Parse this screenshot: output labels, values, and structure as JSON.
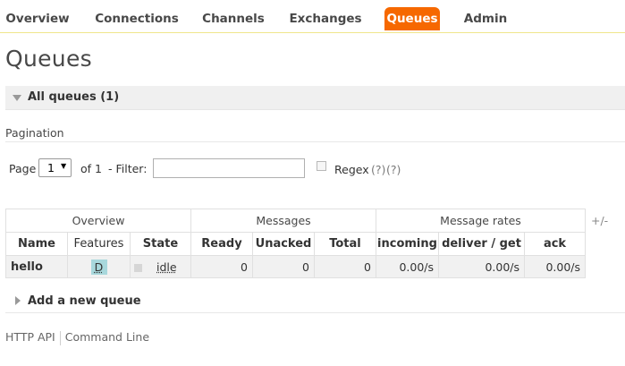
{
  "nav": {
    "tabs": [
      {
        "label": "Overview",
        "active": false
      },
      {
        "label": "Connections",
        "active": false
      },
      {
        "label": "Channels",
        "active": false
      },
      {
        "label": "Exchanges",
        "active": false
      },
      {
        "label": "Queues",
        "active": true
      },
      {
        "label": "Admin",
        "active": false
      }
    ]
  },
  "page": {
    "title": "Queues"
  },
  "section": {
    "title": "All queues (1)",
    "expanded": true
  },
  "pagination": {
    "label": "Pagination",
    "page_label": "Page",
    "page_value": "1",
    "of_label": "of 1",
    "filter_label": "- Filter:",
    "filter_value": "",
    "regex_label": "Regex",
    "regex_checked": false,
    "help1": "(?)",
    "help2": "(?)"
  },
  "table": {
    "groups": [
      "Overview",
      "Messages",
      "Message rates"
    ],
    "columns_toggle": "+/-",
    "headers": [
      "Name",
      "Features",
      "State",
      "Ready",
      "Unacked",
      "Total",
      "incoming",
      "deliver / get",
      "ack"
    ],
    "rows": [
      {
        "name": "hello",
        "features": "D",
        "state": "idle",
        "ready": "0",
        "unacked": "0",
        "total": "0",
        "incoming": "0.00/s",
        "deliver_get": "0.00/s",
        "ack": "0.00/s"
      }
    ]
  },
  "add_queue": {
    "label": "Add a new queue"
  },
  "footer": {
    "links": [
      "HTTP API",
      "Command Line"
    ]
  },
  "colors": {
    "accent": "#f66800",
    "nav_border": "#f0e68c",
    "feature_badge": "#a8d8dc"
  }
}
